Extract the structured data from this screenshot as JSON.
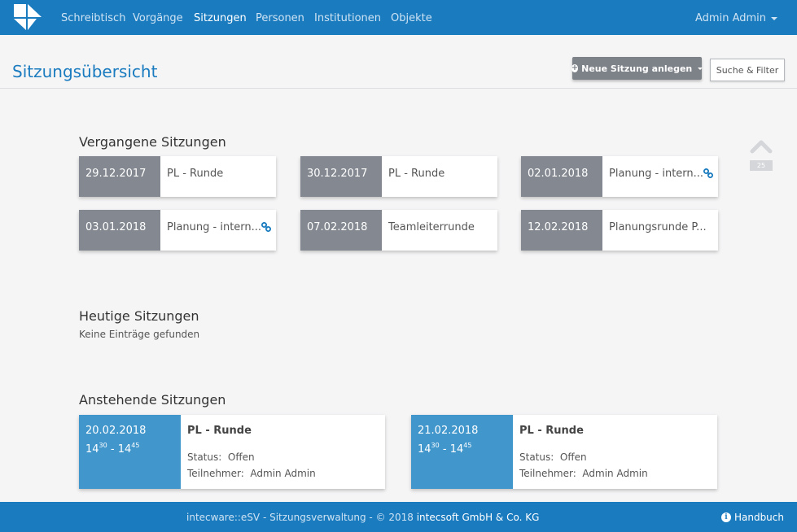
{
  "nav": {
    "items": [
      {
        "label": "Schreibtisch"
      },
      {
        "label": "Vorgänge"
      },
      {
        "label": "Sitzungen"
      },
      {
        "label": "Personen"
      },
      {
        "label": "Institutionen"
      },
      {
        "label": "Objekte"
      }
    ],
    "active": "Sitzungen",
    "user": "Admin Admin"
  },
  "header": {
    "title": "Sitzungsübersicht",
    "new_button": "Neue Sitzung anlegen",
    "filter_button": "Suche & Filter"
  },
  "past": {
    "title": "Vergangene Sitzungen",
    "items": [
      {
        "date": "29.12.2017",
        "name": "PL - Runde",
        "linked": false
      },
      {
        "date": "30.12.2017",
        "name": "PL - Runde",
        "linked": false
      },
      {
        "date": "02.01.2018",
        "name": "Planung - intern...",
        "linked": true
      },
      {
        "date": "03.01.2018",
        "name": "Planung - intern...",
        "linked": true
      },
      {
        "date": "07.02.2018",
        "name": "Teamleiterrunde",
        "linked": false
      },
      {
        "date": "12.02.2018",
        "name": "Planungsrunde P...",
        "linked": false
      }
    ]
  },
  "today": {
    "title": "Heutige Sitzungen",
    "empty": "Keine Einträge gefunden"
  },
  "upcoming": {
    "title": "Anstehende Sitzungen",
    "items": [
      {
        "date": "20.02.2018",
        "start_h": "14",
        "start_m": "30",
        "end_h": "14",
        "end_m": "45",
        "name": "PL - Runde",
        "status_label": "Status:",
        "status": "Offen",
        "participants_label": "Teilnehmer:",
        "participants": "Admin Admin"
      },
      {
        "date": "21.02.2018",
        "start_h": "14",
        "start_m": "30",
        "end_h": "14",
        "end_m": "45",
        "name": "PL - Runde",
        "status_label": "Status:",
        "status": "Offen",
        "participants_label": "Teilnehmer:",
        "participants": "Admin Admin"
      }
    ]
  },
  "scroll_top": {
    "count": "25"
  },
  "footer": {
    "text": "intecware::eSV - Sitzungsverwaltung - © 2018 ",
    "company": "intecsoft GmbH & Co. KG",
    "help": "Handbuch"
  },
  "colors": {
    "primary": "#1a7bbf",
    "past_date": "#848991",
    "upcoming_date": "#4196cc"
  }
}
